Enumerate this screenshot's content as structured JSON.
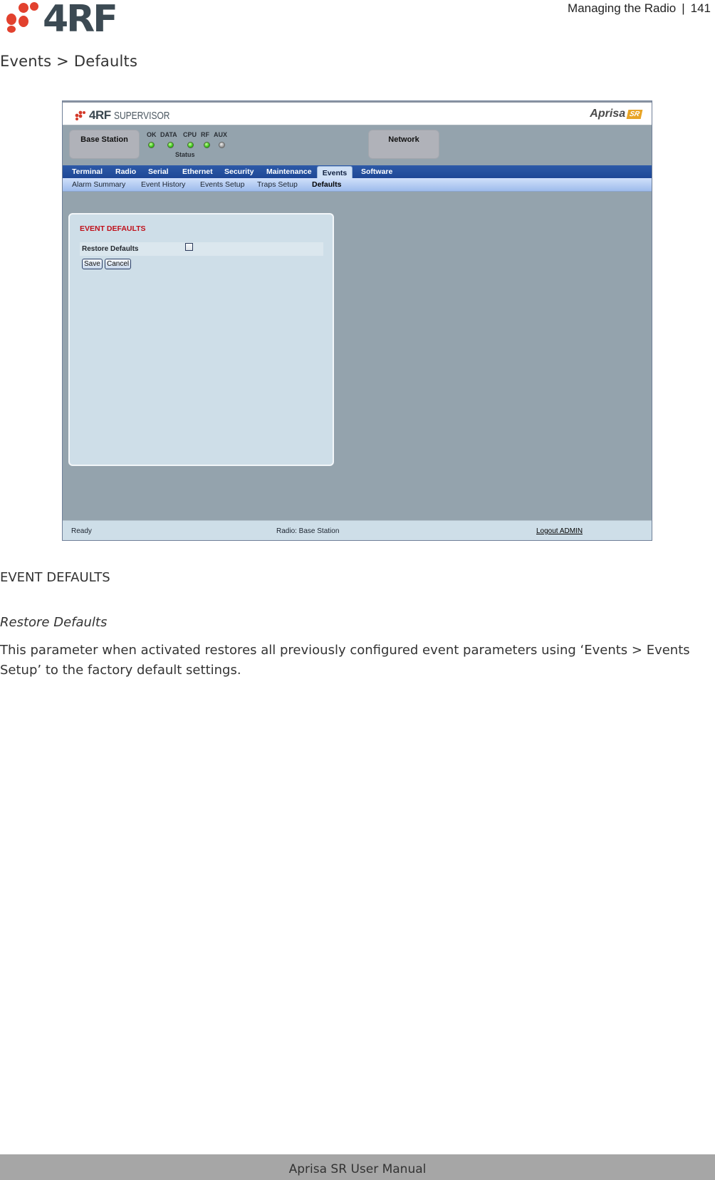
{
  "page": {
    "header_title": "Managing the Radio",
    "header_separator": "|",
    "page_number": "141",
    "section_title": "Events > Defaults",
    "footer": "Aprisa SR User Manual"
  },
  "colors": {
    "logo_red": "#e2412e",
    "logo_grey": "#3c4a53",
    "tabbar_blue": "#2150a0",
    "panel_title_red": "#c0101a",
    "led_green": "#39c21a",
    "footer_grey": "#a6a6a6"
  },
  "app": {
    "brand": "4RF",
    "product": "SUPERVISOR",
    "aprisa_logo": "Aprisa",
    "aprisa_badge": "SR",
    "station_box": "Base Station",
    "network_box": "Network",
    "status_label": "Status",
    "leds": [
      {
        "label": "OK",
        "state": "on"
      },
      {
        "label": "DATA",
        "state": "on"
      },
      {
        "label": "CPU",
        "state": "on"
      },
      {
        "label": "RF",
        "state": "on"
      },
      {
        "label": "AUX",
        "state": "off"
      }
    ],
    "tabs": [
      {
        "label": "Terminal",
        "active": false
      },
      {
        "label": "Radio",
        "active": false
      },
      {
        "label": "Serial",
        "active": false
      },
      {
        "label": "Ethernet",
        "active": false
      },
      {
        "label": "Security",
        "active": false
      },
      {
        "label": "Maintenance",
        "active": false
      },
      {
        "label": "Events",
        "active": true
      },
      {
        "label": "Software",
        "active": false
      }
    ],
    "subtabs": [
      {
        "label": "Alarm Summary",
        "active": false
      },
      {
        "label": "Event History",
        "active": false
      },
      {
        "label": "Events Setup",
        "active": false
      },
      {
        "label": "Traps Setup",
        "active": false
      },
      {
        "label": "Defaults",
        "active": true
      }
    ],
    "panel": {
      "title": "EVENT DEFAULTS",
      "field_label": "Restore Defaults",
      "field_checked": false,
      "save_label": "Save",
      "cancel_label": "Cancel"
    },
    "statusbar": {
      "ready": "Ready",
      "radio": "Radio: Base Station",
      "logout": "Logout ADMIN"
    }
  },
  "doc": {
    "heading": "EVENT DEFAULTS",
    "param_title": "Restore Defaults",
    "param_desc": "This parameter when activated restores all previously configured event parameters using ‘Events > Events Setup’ to the factory default settings."
  }
}
